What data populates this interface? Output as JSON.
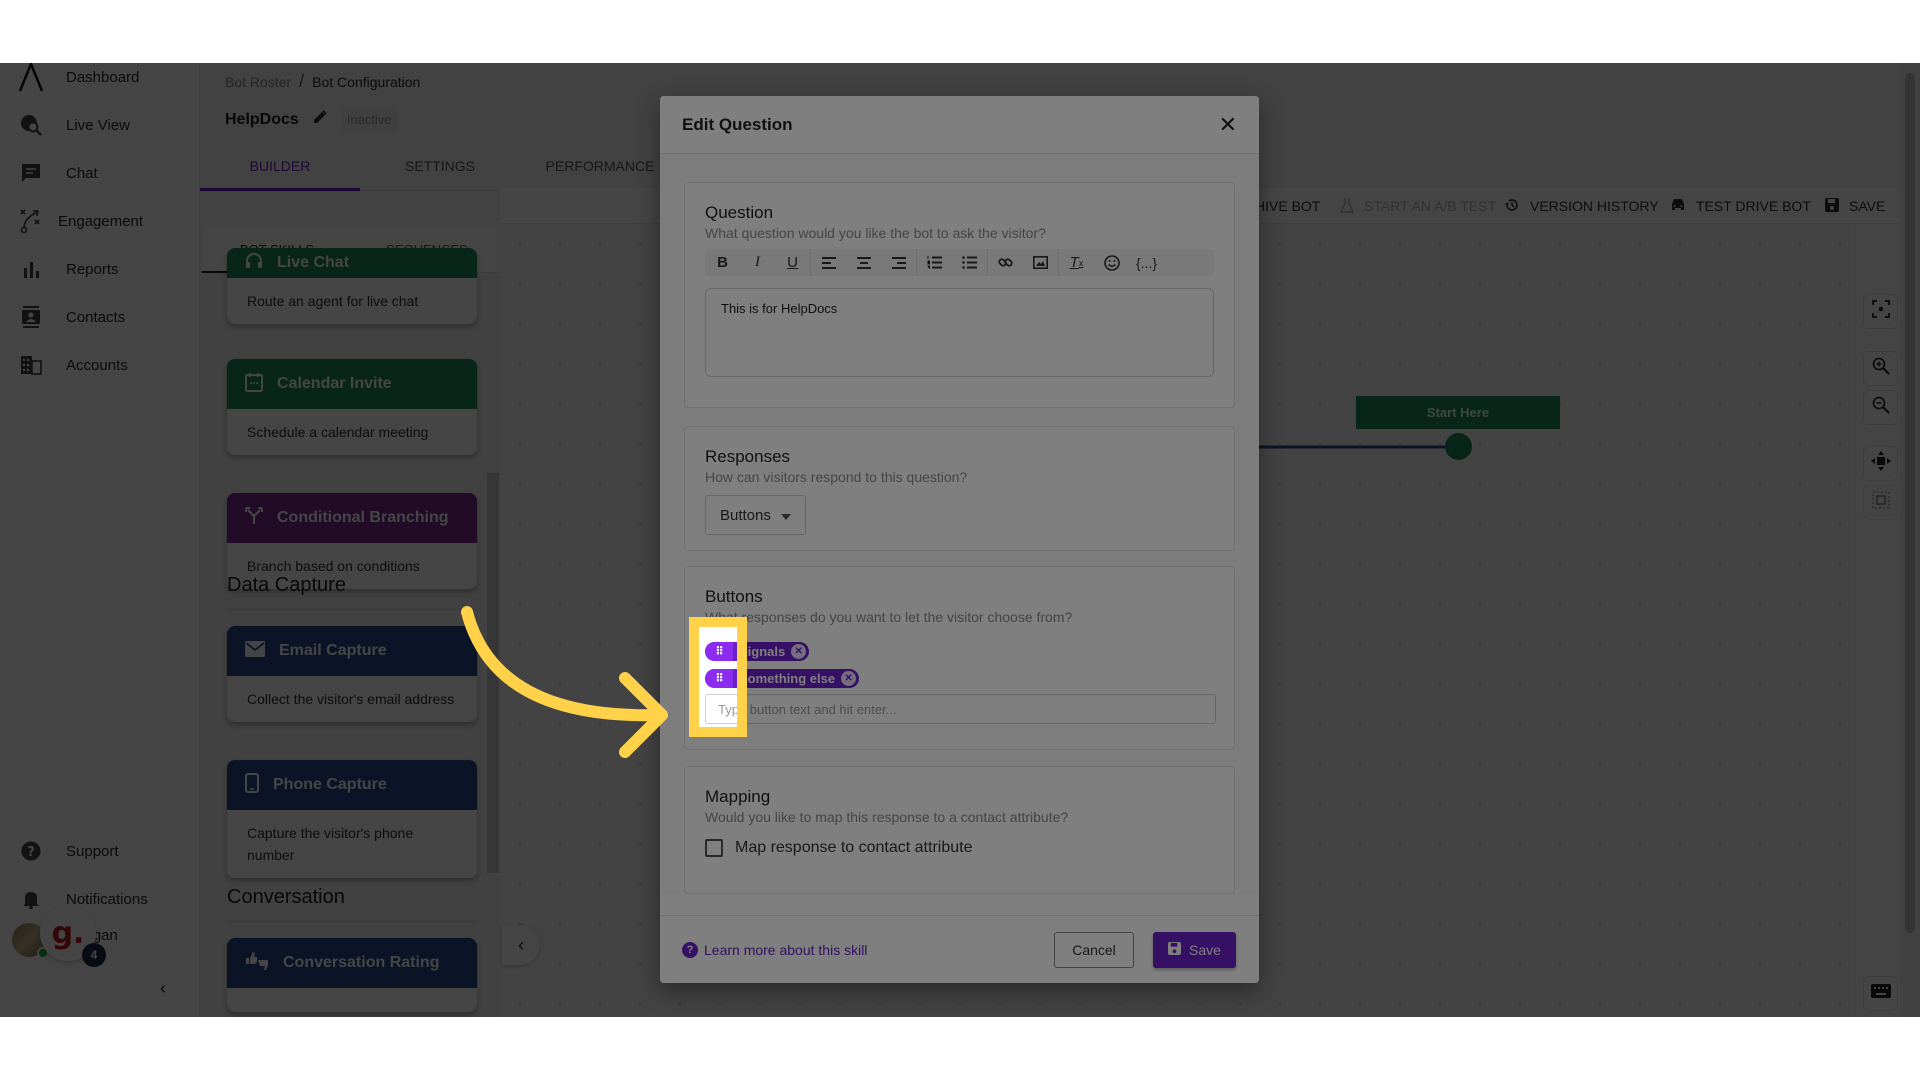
{
  "sidebar": {
    "items": [
      {
        "label": "Dashboard",
        "icon": "logo-icon"
      },
      {
        "label": "Live View",
        "icon": "live-view-icon"
      },
      {
        "label": "Chat",
        "icon": "chat-icon"
      },
      {
        "label": "Engagement",
        "icon": "engagement-icon"
      },
      {
        "label": "Reports",
        "icon": "bar-chart-icon"
      },
      {
        "label": "Contacts",
        "icon": "contacts-icon"
      },
      {
        "label": "Accounts",
        "icon": "building-icon"
      }
    ],
    "bottom": [
      {
        "label": "Support",
        "icon": "help-icon"
      },
      {
        "label": "Notifications",
        "icon": "bell-icon"
      }
    ],
    "user_name": "Ngan",
    "g_logo": "g.",
    "g_count": "4",
    "collapse": "‹"
  },
  "header": {
    "breadcrumb": [
      "Bot Roster",
      "Bot Configuration"
    ],
    "breadcrumb_sep": "/",
    "bot_name": "HelpDocs",
    "status": "Inactive",
    "tabs": [
      "BUILDER",
      "SETTINGS",
      "PERFORMANCE"
    ],
    "active_tab": "BUILDER"
  },
  "actionbar": {
    "archive": "HIVE BOT",
    "ab_test": "START AN A/B TEST",
    "version_history": "VERSION HISTORY",
    "test_drive": "TEST DRIVE BOT",
    "save": "SAVE"
  },
  "skills": {
    "tabs": [
      "BOT SKILLS",
      "SEQUENCES"
    ],
    "cards": [
      {
        "title": "Live Chat",
        "desc": "Route an agent for live chat",
        "color": "#1e8a5e"
      },
      {
        "title": "Calendar Invite",
        "desc": "Schedule a calendar meeting",
        "color": "#1e8a5e"
      },
      {
        "title": "Conditional Branching",
        "desc": "Branch based on conditions",
        "color": "#7a2a8f"
      },
      {
        "title": "Email Capture",
        "desc": "Collect the visitor's email address",
        "color": "#2a4a8f"
      },
      {
        "title": "Phone Capture",
        "desc": "Capture the visitor's phone number",
        "color": "#2a4a8f"
      },
      {
        "title": "Conversation Rating",
        "desc": "",
        "color": "#2a4a8f"
      }
    ],
    "sections": [
      "Data Capture",
      "Conversation"
    ]
  },
  "canvas": {
    "start_node": "Start Here"
  },
  "modal": {
    "title": "Edit Question",
    "question": {
      "heading": "Question",
      "sub": "What question would you like the bot to ask the visitor?",
      "text": "This is for HelpDocs",
      "toolbar": [
        "bold",
        "italic",
        "underline",
        "align-left",
        "align-center",
        "align-right",
        "ordered-list",
        "bullet-list",
        "link",
        "image",
        "clear-format",
        "emoji",
        "variable"
      ]
    },
    "responses": {
      "heading": "Responses",
      "sub": "How can visitors respond to this question?",
      "selected": "Buttons"
    },
    "buttons": {
      "heading": "Buttons",
      "sub": "What responses do you want to let the visitor choose from?",
      "chips": [
        "Signals",
        "Something else"
      ],
      "input_placeholder": "Type button text and hit enter..."
    },
    "mapping": {
      "heading": "Mapping",
      "sub": "Would you like to map this response to a contact attribute?",
      "checkbox_label": "Map response to contact attribute",
      "checked": false
    },
    "footer": {
      "learn_more": "Learn more about this skill",
      "cancel": "Cancel",
      "save": "Save"
    }
  },
  "annotation": {
    "highlight_color": "#ffd24a",
    "target": "button drag handles"
  }
}
